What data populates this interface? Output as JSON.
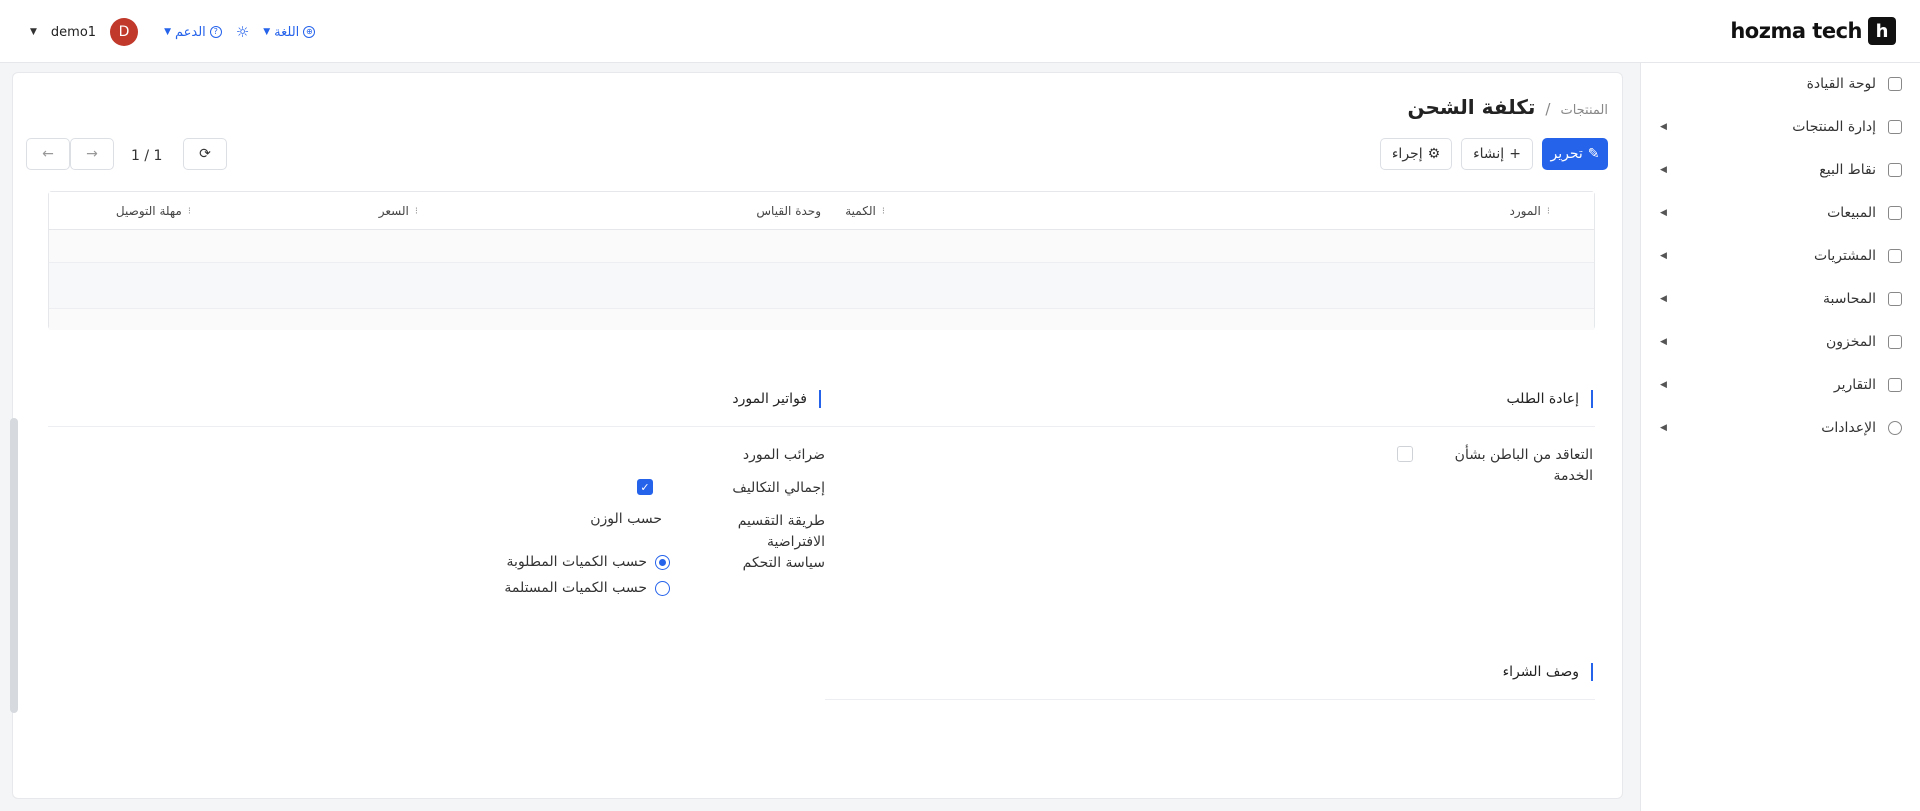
{
  "topbar": {
    "brand": "hozma tech",
    "brand_letter": "h",
    "user": "demo1",
    "avatar_letter": "D",
    "support": "الدعم",
    "language": "اللغة"
  },
  "sidebar": {
    "items": [
      {
        "label": "لوحة القيادة",
        "icon": "dashboard-icon"
      },
      {
        "label": "إدارة المنتجات",
        "icon": "tag-icon"
      },
      {
        "label": "نقاط البيع",
        "icon": "store-icon"
      },
      {
        "label": "المبيعات",
        "icon": "chart-icon"
      },
      {
        "label": "المشتريات",
        "icon": "wallet-icon"
      },
      {
        "label": "المحاسبة",
        "icon": "ledger-icon"
      },
      {
        "label": "المخزون",
        "icon": "box-icon"
      },
      {
        "label": "التقارير",
        "icon": "report-icon"
      },
      {
        "label": "الإعدادات",
        "icon": "gear-icon"
      }
    ]
  },
  "breadcrumb": {
    "root": "المنتجات",
    "separator": "/",
    "title": "تكلفة الشحن"
  },
  "toolbar": {
    "edit": "تحرير",
    "create": "إنشاء",
    "action": "إجراء",
    "pager": "1 / 1"
  },
  "table": {
    "headers": [
      "المورد",
      "الكمية",
      "وحدة القياس",
      "السعر",
      "مهلة التوصيل"
    ]
  },
  "sections": {
    "reorder": "إعادة الطلب",
    "vendor_bills": "فواتير المورد",
    "purchase_description": "وصف الشراء"
  },
  "fields": {
    "subcontract_label_1": "التعاقد من الباطن بشأن",
    "subcontract_label_2": "الخدمة",
    "vendor_taxes": "ضرائب المورد",
    "total_costs": "إجمالي التكاليف",
    "split_method_1": "طريقة التقسيم",
    "split_method_2": "الافتراضية",
    "split_method_value": "حسب الوزن",
    "control_policy": "سياسة التحكم",
    "policy_ordered": "حسب الكميات المطلوبة",
    "policy_received": "حسب الكميات المستلمة"
  }
}
